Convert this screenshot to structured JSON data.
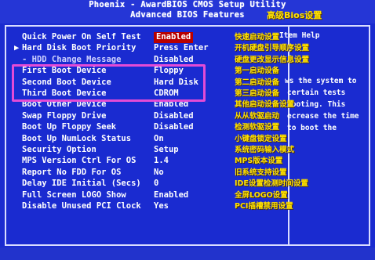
{
  "title": {
    "line1": "Phoenix - AwardBIOS CMOS Setup Utility",
    "line2": "Advanced BIOS Features",
    "chinese_overlay": "高级Bios设置"
  },
  "settings": [
    {
      "marker": "",
      "label": "Quick Power On Self Test",
      "value": "Enabled",
      "highlighted": true
    },
    {
      "marker": "▶",
      "label": "Hard Disk Boot Priority",
      "value": "Press Enter"
    },
    {
      "marker": "",
      "label": "- HDD Change Message",
      "value": "Disabled"
    },
    {
      "marker": "",
      "label": "First Boot Device",
      "value": "Floppy"
    },
    {
      "marker": "",
      "label": "Second Boot Device",
      "value": "Hard Disk"
    },
    {
      "marker": "",
      "label": "Third Boot Device",
      "value": "CDROM"
    },
    {
      "marker": "",
      "label": "Boot Other Device",
      "value": "Enabled"
    },
    {
      "marker": "",
      "label": "Swap Floppy Drive",
      "value": "Disabled"
    },
    {
      "marker": "",
      "label": "Boot Up Floppy Seek",
      "value": "Disabled"
    },
    {
      "marker": "",
      "label": "Boot Up NumLock Status",
      "value": "On"
    },
    {
      "marker": "",
      "label": "Security Option",
      "value": "Setup"
    },
    {
      "marker": "",
      "label": "MPS Version Ctrl For OS",
      "value": "1.4"
    },
    {
      "marker": "",
      "label": "Report No FDD For OS",
      "value": "No"
    },
    {
      "marker": "",
      "label": "Delay IDE Initial (Secs)",
      "value": "0"
    },
    {
      "marker": "",
      "label": "Full Screen LOGO Show",
      "value": "Enabled"
    },
    {
      "marker": "",
      "label": "Disable Unused PCI Clock",
      "value": "Yes"
    }
  ],
  "annotations": [
    "快速启动设置",
    "开机硬盘引导顺序设置",
    "硬盘更改显示信息设置",
    "第一启动设备",
    "第二启动设备",
    "第三启动设备",
    "其他启动设备设置",
    "从从软驱启动",
    "检测软驱设置",
    "小键盘锁定设置",
    "系统密码输入模式",
    "MPS版本设置",
    "旧系统支持设置",
    "IDE设置检测时间设置",
    "全屏LOGO设置",
    "PCI插槽禁用设置"
  ],
  "help_panel": {
    "title": "Item Help",
    "lines": [
      "ws the system to",
      "certain tests",
      "booting. This",
      "ecrease the time",
      "to boot the"
    ]
  },
  "colors": {
    "background": "#1a2bd0",
    "selection": "#b80000",
    "annotation": "#ffe100",
    "highlight_box": "#e44bd6"
  }
}
